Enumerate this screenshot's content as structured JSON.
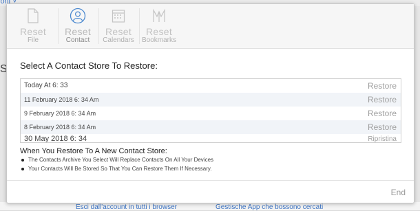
{
  "background": {
    "top_link": "ioni ˅",
    "letter": "S",
    "bottom_links": [
      "Esci dall'account in tutti i browser",
      "Gestische App che bossono cercati"
    ]
  },
  "toolbar": {
    "items": [
      {
        "label": "Reset",
        "sublabel": "File",
        "icon": "file-icon"
      },
      {
        "label": "Reset",
        "sublabel": "Contact",
        "icon": "contact-icon"
      },
      {
        "label": "Reset",
        "sublabel": "Calendars",
        "icon": "calendar-icon"
      },
      {
        "label": "Reset",
        "sublabel": "Bookmarks",
        "icon": "bookmark-icon"
      }
    ]
  },
  "restore": {
    "title": "Select A Contact Store To Restore:",
    "rows": [
      {
        "date": "Today At 6: 33",
        "action": "Restore"
      },
      {
        "date": "11 February 2018 6: 34 Am",
        "action": "Restore"
      },
      {
        "date": "9 February 2018 6: 34 Am",
        "action": "Restore"
      },
      {
        "date": "8 February 2018 6: 34 Am",
        "action": "Restore"
      },
      {
        "date": "30 May 2018 6: 34",
        "action": "Ripristina"
      }
    ]
  },
  "info": {
    "title": "When You Restore To A New Contact Store:",
    "bullets": [
      "The Contacts Archive You Select Will Replace Contacts On All Your Devices",
      "Your Contacts Will Be Stored So That You Can Restore Them If Necessary."
    ]
  },
  "footer": {
    "end_label": "End"
  }
}
